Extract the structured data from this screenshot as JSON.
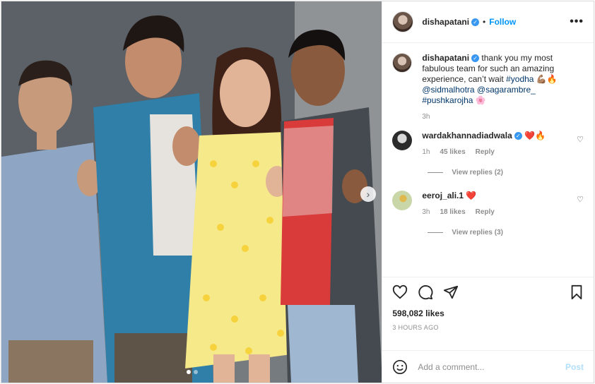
{
  "post": {
    "username": "dishapatani",
    "follow_label": "Follow",
    "more_label": "•••",
    "caption": {
      "username": "dishapatani",
      "text_before": "thank you my most fabulous team for such an amazing experience, can’t wait",
      "hashtag1": "#yodha",
      "emoji1": "💪🏽🔥",
      "mention1": "@sidmalhotra",
      "mention2": "@sagarambre_",
      "hashtag2": "#pushkarojha",
      "emoji2": "🌸",
      "time": "3h"
    },
    "comments": [
      {
        "username": "wardakhannadiadwala",
        "text": "❤️🔥",
        "time": "1h",
        "likes": "45 likes",
        "reply": "Reply",
        "view_replies": "View replies (2)",
        "avatar_color": "#2b2b2b"
      },
      {
        "username": "eeroj_ali.1",
        "text": "❤️",
        "time": "3h",
        "likes": "18 likes",
        "reply": "Reply",
        "view_replies": "View replies (3)",
        "avatar_color": "#c9d6a8"
      }
    ],
    "likes_count": "598,082 likes",
    "time_ago": "3 HOURS AGO",
    "add_comment_placeholder": "Add a comment...",
    "post_button": "Post",
    "icons": {
      "like": "heart-icon",
      "comment": "comment-icon",
      "share": "share-icon",
      "save": "bookmark-icon",
      "emoji": "emoji-icon",
      "next": "chevron-right-icon"
    },
    "carousel": {
      "total": 2,
      "active": 1
    },
    "colors": {
      "link_blue": "#0095f6",
      "hashtag_blue": "#00376b",
      "muted": "#8e8e8e"
    }
  }
}
